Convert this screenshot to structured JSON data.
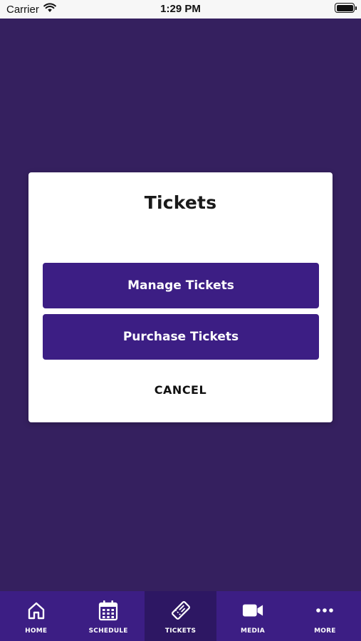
{
  "status_bar": {
    "carrier": "Carrier",
    "time": "1:29 PM"
  },
  "modal": {
    "title": "Tickets",
    "manage_label": "Manage Tickets",
    "purchase_label": "Purchase Tickets",
    "cancel_label": "CANCEL"
  },
  "tab_bar": {
    "active": "tickets",
    "items": [
      {
        "label": "HOME",
        "icon": "home-icon"
      },
      {
        "label": "SCHEDULE",
        "icon": "calendar-icon"
      },
      {
        "label": "TICKETS",
        "icon": "ticket-icon"
      },
      {
        "label": "MEDIA",
        "icon": "video-camera-icon"
      },
      {
        "label": "MORE",
        "icon": "more-dots-icon"
      }
    ]
  },
  "colors": {
    "background": "#35205f",
    "primary": "#3c1e84",
    "active_tab": "#2d1763"
  }
}
